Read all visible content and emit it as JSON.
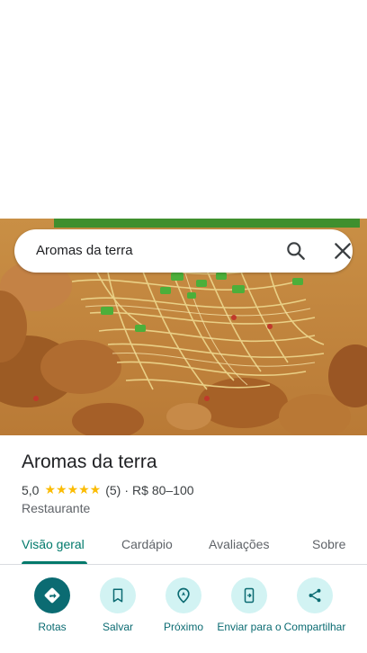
{
  "search": {
    "query": "Aromas da terra"
  },
  "place": {
    "name": "Aromas da terra",
    "rating": "5,0",
    "stars": "★★★★★",
    "review_count": "(5)",
    "separator": "·",
    "price_range": "R$ 80–100",
    "category": "Restaurante"
  },
  "tabs": [
    {
      "label": "Visão geral",
      "active": true
    },
    {
      "label": "Cardápio",
      "active": false
    },
    {
      "label": "Avaliações",
      "active": false
    },
    {
      "label": "Sobre",
      "active": false
    }
  ],
  "actions": [
    {
      "label": "Rotas",
      "icon": "directions-icon"
    },
    {
      "label": "Salvar",
      "icon": "bookmark-icon"
    },
    {
      "label": "Próximo",
      "icon": "nearby-icon"
    },
    {
      "label": "Enviar para o",
      "icon": "send-to-phone-icon"
    },
    {
      "label": "Compartilhar",
      "icon": "share-icon"
    }
  ],
  "colors": {
    "accent": "#00796b",
    "action_primary": "#0b6b72",
    "action_bg": "#d2f3f3",
    "star": "#fbbc04"
  }
}
